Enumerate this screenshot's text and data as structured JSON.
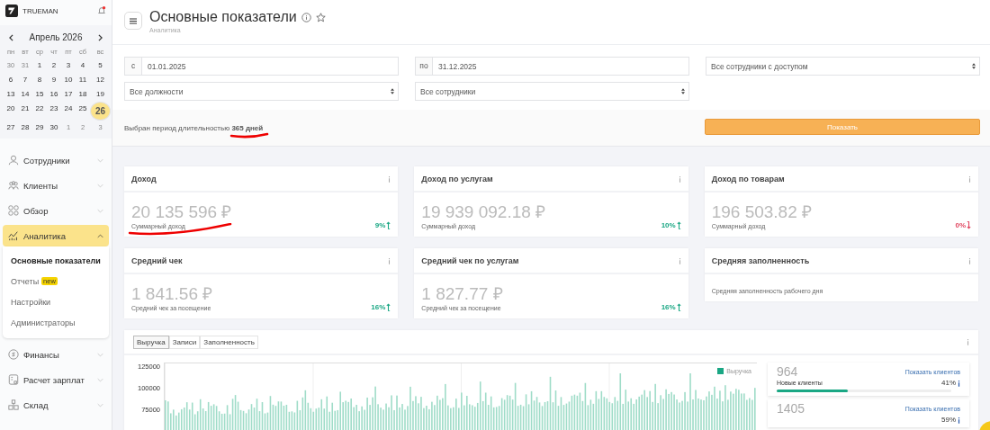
{
  "brand": {
    "name": "TRUEMAN",
    "notifications": true
  },
  "calendar": {
    "month": "Апрель 2026",
    "weekdays": [
      "пн",
      "вт",
      "ср",
      "чт",
      "пт",
      "сб",
      "вс"
    ],
    "weeks": [
      [
        {
          "day": "30",
          "muted": true,
          "selected": false
        },
        {
          "day": "31",
          "muted": true,
          "selected": false
        },
        {
          "day": "1",
          "muted": false,
          "selected": false
        },
        {
          "day": "2",
          "muted": false,
          "selected": false
        },
        {
          "day": "3",
          "muted": false,
          "selected": false
        },
        {
          "day": "4",
          "muted": false,
          "selected": false
        },
        {
          "day": "5",
          "muted": false,
          "selected": false
        }
      ],
      [
        {
          "day": "6",
          "muted": false,
          "selected": false
        },
        {
          "day": "7",
          "muted": false,
          "selected": false
        },
        {
          "day": "8",
          "muted": false,
          "selected": false
        },
        {
          "day": "9",
          "muted": false,
          "selected": false
        },
        {
          "day": "10",
          "muted": false,
          "selected": false
        },
        {
          "day": "11",
          "muted": false,
          "selected": false
        },
        {
          "day": "12",
          "muted": false,
          "selected": false
        }
      ],
      [
        {
          "day": "13",
          "muted": false,
          "selected": false
        },
        {
          "day": "14",
          "muted": false,
          "selected": false
        },
        {
          "day": "15",
          "muted": false,
          "selected": false
        },
        {
          "day": "16",
          "muted": false,
          "selected": false
        },
        {
          "day": "17",
          "muted": false,
          "selected": false
        },
        {
          "day": "18",
          "muted": false,
          "selected": false
        },
        {
          "day": "19",
          "muted": false,
          "selected": false
        }
      ],
      [
        {
          "day": "20",
          "muted": false,
          "selected": false
        },
        {
          "day": "21",
          "muted": false,
          "selected": false
        },
        {
          "day": "22",
          "muted": false,
          "selected": false
        },
        {
          "day": "23",
          "muted": false,
          "selected": false
        },
        {
          "day": "24",
          "muted": false,
          "selected": false
        },
        {
          "day": "25",
          "muted": false,
          "selected": false
        },
        {
          "day": "26",
          "muted": false,
          "selected": true
        }
      ],
      [
        {
          "day": "27",
          "muted": false,
          "selected": false
        },
        {
          "day": "28",
          "muted": false,
          "selected": false
        },
        {
          "day": "29",
          "muted": false,
          "selected": false
        },
        {
          "day": "30",
          "muted": false,
          "selected": false
        },
        {
          "day": "1",
          "muted": true,
          "selected": false
        },
        {
          "day": "2",
          "muted": true,
          "selected": false
        },
        {
          "day": "3",
          "muted": true,
          "selected": false
        }
      ]
    ]
  },
  "nav": [
    {
      "label": "Сотрудники",
      "kind": "person",
      "expanded": false
    },
    {
      "label": "Клиенты",
      "kind": "people",
      "expanded": false
    },
    {
      "label": "Обзор",
      "kind": "grid",
      "expanded": false
    },
    {
      "label": "Аналитика",
      "kind": "chart",
      "expanded": true,
      "children": [
        {
          "label": "Основные показатели",
          "selected": true
        },
        {
          "label": "Отчеты",
          "selected": false,
          "badge": "new"
        },
        {
          "label": "Настройки",
          "selected": false
        },
        {
          "label": "Администраторы",
          "selected": false
        }
      ]
    },
    {
      "label": "Финансы",
      "kind": "coin",
      "expanded": false
    },
    {
      "label": "Расчет зарплат",
      "kind": "calc",
      "expanded": false
    },
    {
      "label": "Склад",
      "kind": "boxes",
      "expanded": false
    }
  ],
  "header": {
    "title": "Основные показатели",
    "breadcrumb": "Аналитика"
  },
  "filters": {
    "from": {
      "label": "с",
      "value": "01.01.2025"
    },
    "to": {
      "label": "по",
      "value": "31.12.2025"
    },
    "access": "Все сотрудники с доступом",
    "positions": "Все должности",
    "employees": "Все сотрудники"
  },
  "period_note": {
    "text": "Выбран период длительностью **365 дней**",
    "underlined": true
  },
  "show_button": "Показать",
  "kpis": [
    {
      "title": "Доход",
      "value": "20 135 596 ₽",
      "caption": "Суммарный доход",
      "change": "9%",
      "rising": true,
      "underlined": true
    },
    {
      "title": "Доход по услугам",
      "value": "19 939 092.18 ₽",
      "caption": "Суммарный доход",
      "change": "10%",
      "rising": true,
      "underlined": false
    },
    {
      "title": "Доход по товарам",
      "value": "196 503.82 ₽",
      "caption": "Суммарный доход",
      "change": "0%",
      "rising": false,
      "underlined": false
    },
    {
      "title": "Средний чек",
      "value": "1 841.56 ₽",
      "caption": "Средний чек за посещение",
      "change": "16%",
      "rising": true,
      "underlined": false
    },
    {
      "title": "Средний чек по услугам",
      "value": "1 827.77 ₽",
      "caption": "Средний чек за посещение",
      "change": "16%",
      "rising": true,
      "underlined": false
    },
    {
      "title": "Средняя заполненность",
      "caption": "Средняя заполненность рабочего дня",
      "underlined": false
    }
  ],
  "chart_panel": {
    "tabs": [
      {
        "label": "Выручка",
        "selected": true
      },
      {
        "label": "Записи",
        "selected": false
      },
      {
        "label": "Заполненность",
        "selected": false
      }
    ],
    "y_labels": [
      "125000",
      "100000",
      "75000"
    ],
    "legend": "Выручка",
    "stats": [
      {
        "count": "964",
        "link": "Показать клиентов",
        "label": "Новые клиенты",
        "percent": "41%",
        "level": 0.41
      },
      {
        "count": "1405",
        "link": "Показать клиентов",
        "percent": "59%"
      }
    ]
  }
}
